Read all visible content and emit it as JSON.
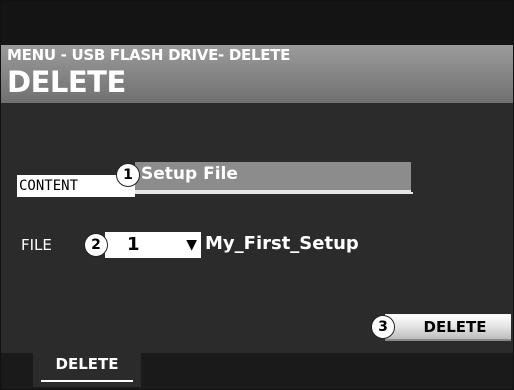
{
  "header": {
    "menu_path": "MENU - USB FLASH DRIVE- DELETE",
    "title": "DELETE"
  },
  "content": {
    "label": "CONTENT",
    "badge": "1",
    "value": "Setup File"
  },
  "file": {
    "label": "FILE",
    "badge": "2",
    "number": "1",
    "dropdown_icon": "triangle-down-icon",
    "name": "My_First_Setup"
  },
  "delete_button": {
    "badge": "3",
    "label": "DELETE"
  },
  "tabs": [
    {
      "label": "DELETE",
      "selected": true
    }
  ],
  "colors": {
    "background": "#2b2b2b",
    "header_gradient_top": "#9b9b9b",
    "header_gradient_bottom": "#707070",
    "top_bar": "#141414",
    "tab_bar": "#1a1a1a",
    "text": "#ffffff"
  }
}
